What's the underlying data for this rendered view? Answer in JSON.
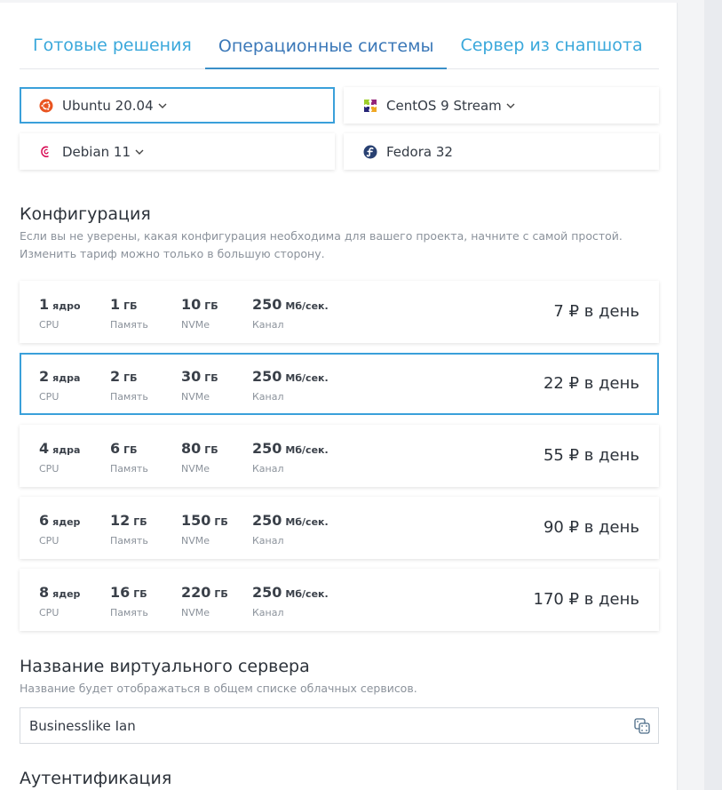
{
  "tabs": [
    {
      "label": "Готовые решения"
    },
    {
      "label": "Операционные системы",
      "active": true
    },
    {
      "label": "Сервер из снапшота"
    }
  ],
  "os_options": [
    {
      "label": "Ubuntu 20.04",
      "icon": "ubuntu-icon",
      "has_dropdown": true,
      "selected": true
    },
    {
      "label": "CentOS 9 Stream",
      "icon": "centos-icon",
      "has_dropdown": true,
      "selected": false
    },
    {
      "label": "Debian 11",
      "icon": "debian-icon",
      "has_dropdown": true,
      "selected": false
    },
    {
      "label": "Fedora 32",
      "icon": "fedora-icon",
      "has_dropdown": false,
      "selected": false
    }
  ],
  "configuration": {
    "title": "Конфигурация",
    "description_line1": "Если вы не уверены, какая конфигурация необходима для вашего проекта, начните с самой простой.",
    "description_line2": "Изменить тариф можно только в большую сторону.",
    "labels": {
      "cpu": "CPU",
      "ram": "Память",
      "disk": "NVMe",
      "net": "Канал"
    },
    "plans": [
      {
        "cpu": "1",
        "cpu_unit": "ядро",
        "ram": "1",
        "ram_unit": "ГБ",
        "disk": "10",
        "disk_unit": "ГБ",
        "net": "250",
        "net_unit": "Мб/сек.",
        "price": "7 ₽ в день",
        "selected": false
      },
      {
        "cpu": "2",
        "cpu_unit": "ядра",
        "ram": "2",
        "ram_unit": "ГБ",
        "disk": "30",
        "disk_unit": "ГБ",
        "net": "250",
        "net_unit": "Мб/сек.",
        "price": "22 ₽ в день",
        "selected": true
      },
      {
        "cpu": "4",
        "cpu_unit": "ядра",
        "ram": "6",
        "ram_unit": "ГБ",
        "disk": "80",
        "disk_unit": "ГБ",
        "net": "250",
        "net_unit": "Мб/сек.",
        "price": "55 ₽ в день",
        "selected": false
      },
      {
        "cpu": "6",
        "cpu_unit": "ядер",
        "ram": "12",
        "ram_unit": "ГБ",
        "disk": "150",
        "disk_unit": "ГБ",
        "net": "250",
        "net_unit": "Мб/сек.",
        "price": "90 ₽ в день",
        "selected": false
      },
      {
        "cpu": "8",
        "cpu_unit": "ядер",
        "ram": "16",
        "ram_unit": "ГБ",
        "disk": "220",
        "disk_unit": "ГБ",
        "net": "250",
        "net_unit": "Мб/сек.",
        "price": "170 ₽ в день",
        "selected": false
      }
    ]
  },
  "server_name": {
    "title": "Название виртуального сервера",
    "description": "Название будет отображаться в общем списке облачных сервисов.",
    "value": "Businesslike Ian",
    "generate_icon": "dice-icon"
  },
  "auth": {
    "title": "Аутентификация"
  },
  "colors": {
    "accent": "#3aa0da",
    "tab_text": "#3aa8db",
    "active_tab": "#3b78b8",
    "ubuntu": "#e95420",
    "fedora": "#294172",
    "debian": "#d70a53"
  }
}
